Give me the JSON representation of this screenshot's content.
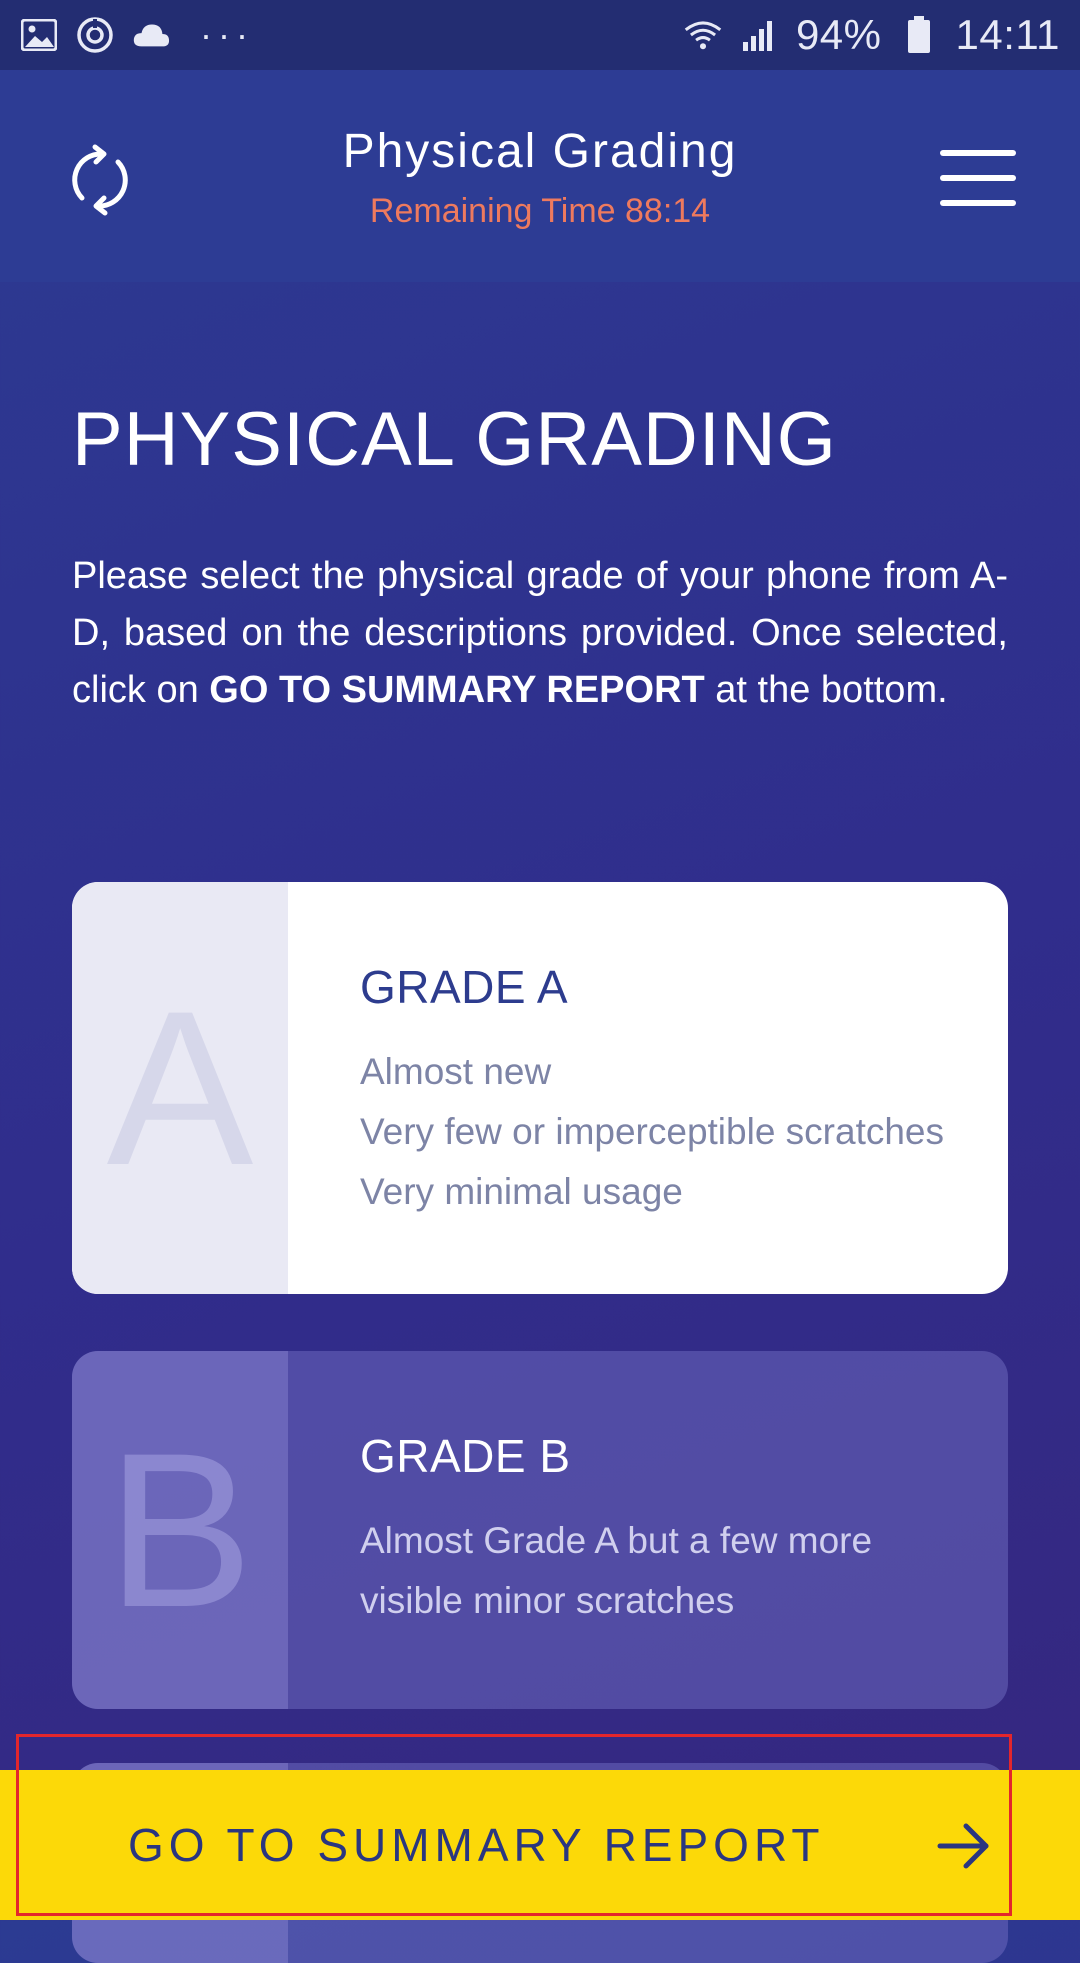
{
  "status_bar": {
    "battery": "94%",
    "time": "14:11",
    "icons": [
      "image-icon",
      "sync-icon",
      "cloud-icon",
      "more-icon",
      "wifi-icon",
      "signal-icon",
      "battery-icon"
    ]
  },
  "header": {
    "title": "Physical Grading",
    "subtitle": "Remaining Time 88:14",
    "left_icon": "refresh-icon",
    "right_icon": "hamburger-menu-icon"
  },
  "main": {
    "heading": "PHYSICAL GRADING",
    "intro_part1": "Please select the physical grade of your phone from A-D, based on the descriptions provided. Once selected, click on ",
    "intro_bold": "GO TO SUMMARY REPORT",
    "intro_part2": " at the bottom.",
    "grades": [
      {
        "letter": "A",
        "title": "GRADE A",
        "lines": [
          "Almost new",
          "Very few or imperceptible scratches",
          "Very minimal usage"
        ],
        "selected": true
      },
      {
        "letter": "B",
        "title": "GRADE B",
        "lines": [
          "Almost Grade A but a few more",
          "visible minor scratches"
        ],
        "selected": false
      }
    ]
  },
  "cta": {
    "label": "GO TO SUMMARY REPORT",
    "icon": "arrow-right-icon"
  },
  "colors": {
    "background": "#302d8c",
    "header": "#2d3c94",
    "accent_timer": "#ee7a5e",
    "cta_background": "#fcd908",
    "cta_text": "#2a3680",
    "highlight_outline": "#e3262c"
  }
}
